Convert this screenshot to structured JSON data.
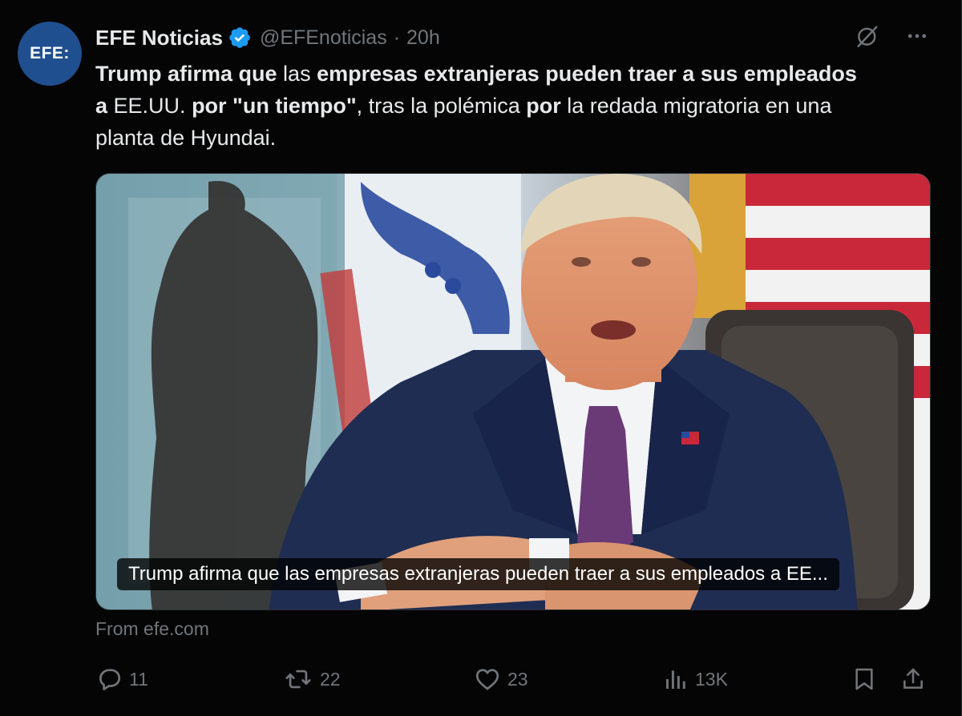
{
  "tweet": {
    "avatar_text": "EFE:",
    "display_name": "EFE Noticias",
    "handle": "@EFEnoticias",
    "separator": "·",
    "time": "20h",
    "text_parts": [
      {
        "text": "Trump afirma que",
        "bold": true
      },
      {
        "text": " las ",
        "bold": false
      },
      {
        "text": "empresas extranjeras pueden traer a sus empleados a",
        "bold": true
      },
      {
        "text": " EE.UU. ",
        "bold": false
      },
      {
        "text": "por \"un tiempo\"",
        "bold": true
      },
      {
        "text": ", tras la polémica ",
        "bold": false
      },
      {
        "text": "por",
        "bold": true
      },
      {
        "text": " la redada migratoria en una planta de Hyundai.",
        "bold": false
      }
    ],
    "media_caption": "Trump afirma que las empresas extranjeras pueden traer a sus empleados a EE...",
    "source": "From efe.com"
  },
  "actions": {
    "replies": "11",
    "reposts": "22",
    "likes": "23",
    "views": "13K"
  },
  "icons": {
    "verified": "verified-badge-icon",
    "grok": "grok-icon",
    "more": "more-icon",
    "reply": "reply-icon",
    "repost": "repost-icon",
    "like": "heart-icon",
    "views": "views-icon",
    "bookmark": "bookmark-icon",
    "share": "share-icon"
  },
  "colors": {
    "background": "#050505",
    "text": "#e7e9ea",
    "muted": "#71767b",
    "verified": "#1d9bf0",
    "avatar": "#1f4f8f"
  }
}
